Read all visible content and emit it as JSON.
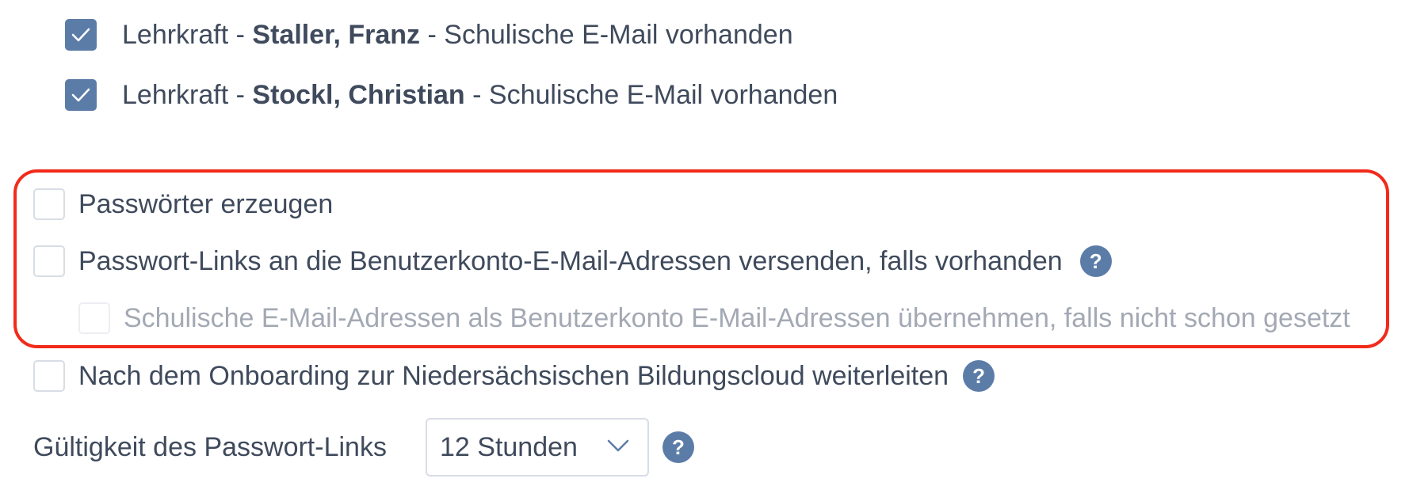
{
  "teachers": [
    {
      "checked": true,
      "role": "Lehrkraft",
      "separator1": " - ",
      "name": "Staller, Franz",
      "separator2": " - ",
      "status": "Schulische E-Mail vorhanden"
    },
    {
      "checked": true,
      "role": "Lehrkraft",
      "separator1": " - ",
      "name": "Stockl, Christian",
      "separator2": " - ",
      "status": "Schulische E-Mail vorhanden"
    }
  ],
  "options": {
    "generate_passwords": {
      "label": "Passwörter erzeugen",
      "checked": false
    },
    "send_password_links": {
      "label": "Passwort-Links an die Benutzerkonto-E-Mail-Adressen versenden, falls vorhanden",
      "checked": false,
      "help_icon": "?"
    },
    "adopt_school_emails": {
      "label": "Schulische E-Mail-Adressen als Benutzerkonto E-Mail-Adressen übernehmen, falls nicht schon gesetzt",
      "checked": false,
      "disabled": true
    },
    "redirect_after_onboarding": {
      "label": "Nach dem Onboarding zur Niedersächsischen Bildungscloud weiterleiten",
      "checked": false,
      "help_icon": "?"
    }
  },
  "link_validity": {
    "label": "Gültigkeit des Passwort-Links",
    "selected": "12 Stunden",
    "help_icon": "?"
  },
  "colors": {
    "accent": "#5c7ca8",
    "text": "#3f4a5c",
    "disabled_text": "#a3a9b4",
    "annotation": "#f22a1a"
  }
}
